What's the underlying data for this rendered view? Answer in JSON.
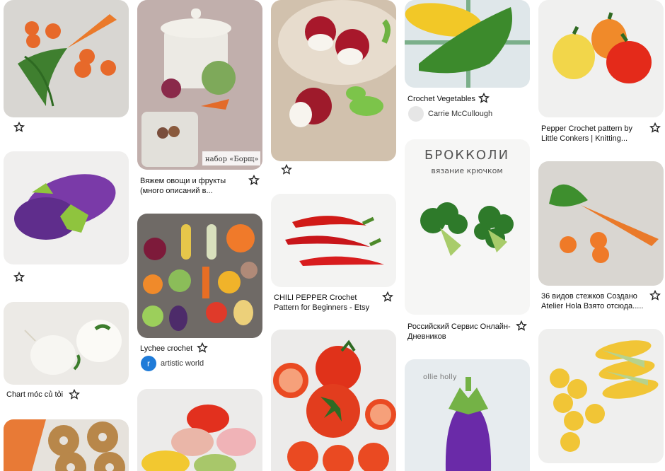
{
  "pins": [
    {
      "id": "carrot-1"
    },
    {
      "id": "eggplant-1"
    },
    {
      "id": "garlic"
    },
    {
      "id": "bagels"
    },
    {
      "id": "pot-set",
      "caption": "Вяжем овощи и фрукты (много описаний в..."
    },
    {
      "id": "lychee",
      "caption": "Lychee crochet",
      "user": "artistic world",
      "avatar_letter": "r"
    },
    {
      "id": "pumpkins"
    },
    {
      "id": "radish"
    },
    {
      "id": "chili",
      "caption": "CHILI PEPPER Crochet Pattern for Beginners - Etsy"
    },
    {
      "id": "tomato"
    },
    {
      "id": "corn-1",
      "caption": "Crochet Vegetables",
      "user": "Carrie McCullough"
    },
    {
      "id": "broccoli",
      "caption": "Российский Сервис Онлайн-Дневников",
      "title": "БРОККОЛИ",
      "subtitle": "вязание крючком"
    },
    {
      "id": "eggplant-2",
      "watermark": "ollie holly"
    },
    {
      "id": "peppers",
      "caption": "Pepper Crochet pattern by Little Conkers | Knitting..."
    },
    {
      "id": "carrot-2",
      "caption": "36 видов стежков Создано Atelier Hola Взято отсюда....."
    },
    {
      "id": "corn-2"
    },
    {
      "id": "garlic-caption",
      "caption": "Chart móc củ tỏi"
    }
  ],
  "pot_label": "набор «Борщ»",
  "colors": {
    "star": "#222222",
    "avatar_blue": "#1f7bd8"
  }
}
